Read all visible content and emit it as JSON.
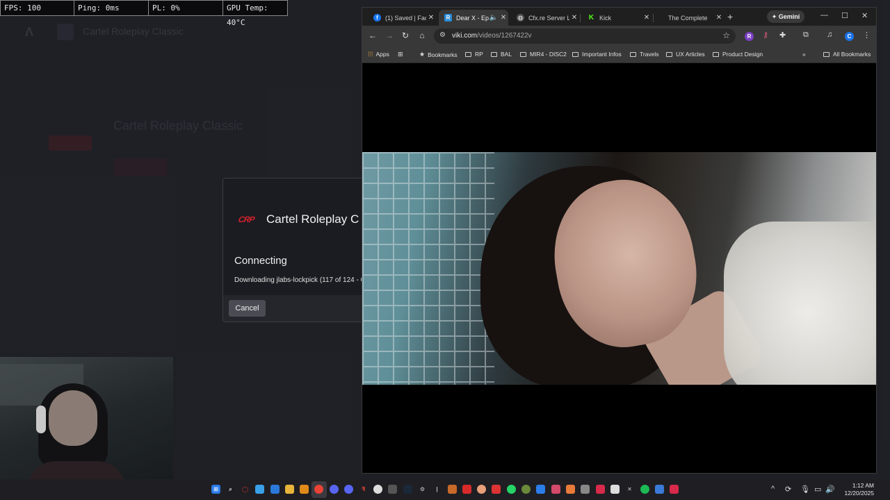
{
  "perf": {
    "fps": "FPS: 100",
    "ping": "Ping: 0ms",
    "pl": "PL: 0%",
    "gpu": "GPU Temp: 40°C"
  },
  "launcher": {
    "header_title": "Cartel Roleplay Classic",
    "server_title": "Cartel Roleplay Classic"
  },
  "dialog": {
    "logo_text": "CRP",
    "title": "Cartel Roleplay C",
    "status": "Connecting",
    "progress": "Downloading jlabs-lockpick (117 of 124 - 0",
    "cancel_label": "Cancel"
  },
  "browser": {
    "tabs": [
      {
        "title": "(1) Saved | Face",
        "icon": "facebook-icon",
        "color": "#1877f2"
      },
      {
        "title": "Dear X - Ep",
        "icon": "viki-icon",
        "color": "#2a8cd8"
      },
      {
        "title": "Cfx.re Server Li",
        "icon": "globe-icon",
        "color": "#555555"
      },
      {
        "title": "Kick",
        "icon": "kick-icon",
        "color": "#53fc18"
      },
      {
        "title": "The Complete",
        "icon": "blank-icon",
        "color": "#1f1f1f"
      }
    ],
    "gemini_label": "Gemini",
    "url_host": "viki.com",
    "url_path": "/videos/1267422v",
    "bookmarks": [
      {
        "label": "Apps",
        "type": "grid"
      },
      {
        "label": "Bookmarks",
        "type": "star"
      },
      {
        "label": "RP",
        "type": "folder"
      },
      {
        "label": "BAL",
        "type": "folder"
      },
      {
        "label": "MIR4 - DISC2",
        "type": "folder"
      },
      {
        "label": "Important Infos",
        "type": "folder"
      },
      {
        "label": "Travels",
        "type": "folder"
      },
      {
        "label": "UX Articles",
        "type": "folder"
      },
      {
        "label": "Product Design",
        "type": "folder"
      }
    ],
    "all_bookmarks": "All Bookmarks"
  },
  "taskbar": {
    "time": "1:12 AM",
    "date": "12/20/2025"
  },
  "colors": {
    "accent_red": "#d3222b",
    "overlay_border": "#8a8a8a"
  }
}
